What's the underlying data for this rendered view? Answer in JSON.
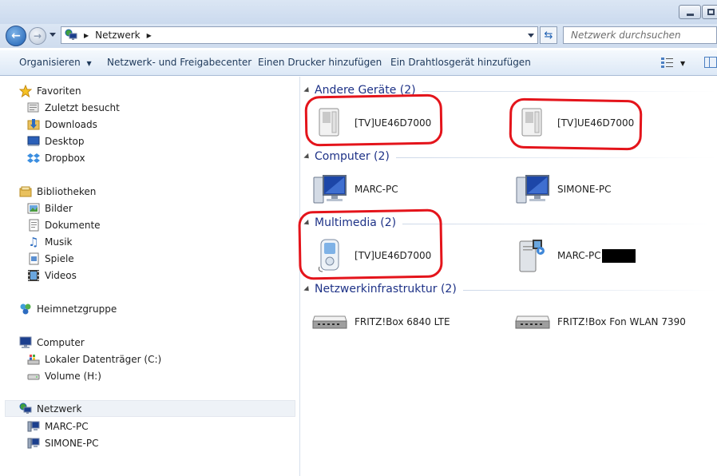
{
  "address": {
    "location": "Netzwerk",
    "search_placeholder": "Netzwerk durchsuchen"
  },
  "toolbar": {
    "organize": "Organisieren",
    "network_center": "Netzwerk- und Freigabecenter",
    "add_printer": "Einen Drucker hinzufügen",
    "add_wireless": "Ein Drahtlosgerät hinzufügen"
  },
  "nav": {
    "favorites": "Favoriten",
    "recent": "Zuletzt besucht",
    "downloads": "Downloads",
    "desktop": "Desktop",
    "dropbox": "Dropbox",
    "libraries": "Bibliotheken",
    "pictures": "Bilder",
    "documents": "Dokumente",
    "music": "Musik",
    "games": "Spiele",
    "videos": "Videos",
    "homegroup": "Heimnetzgruppe",
    "computer": "Computer",
    "local_disk": "Lokaler Datenträger (C:)",
    "volume_h": "Volume (H:)",
    "network": "Netzwerk",
    "net_pc1": "MARC-PC",
    "net_pc2": "SIMONE-PC"
  },
  "groups": {
    "other": "Andere Geräte (2)",
    "computer": "Computer (2)",
    "multimedia": "Multimedia (2)",
    "infra": "Netzwerkinfrastruktur (2)"
  },
  "devices": {
    "other_1": "[TV]UE46D7000",
    "other_2": "[TV]UE46D7000",
    "pc_1": "MARC-PC",
    "pc_2": "SIMONE-PC",
    "mm_1": "[TV]UE46D7000",
    "mm_2": "MARC-PC",
    "infra_1": "FRITZ!Box 6840 LTE",
    "infra_2": "FRITZ!Box Fon WLAN 7390"
  },
  "colors": {
    "group_header": "#1e3287",
    "annotation_red": "#e4141b",
    "toolbar_text": "#1e395b"
  }
}
